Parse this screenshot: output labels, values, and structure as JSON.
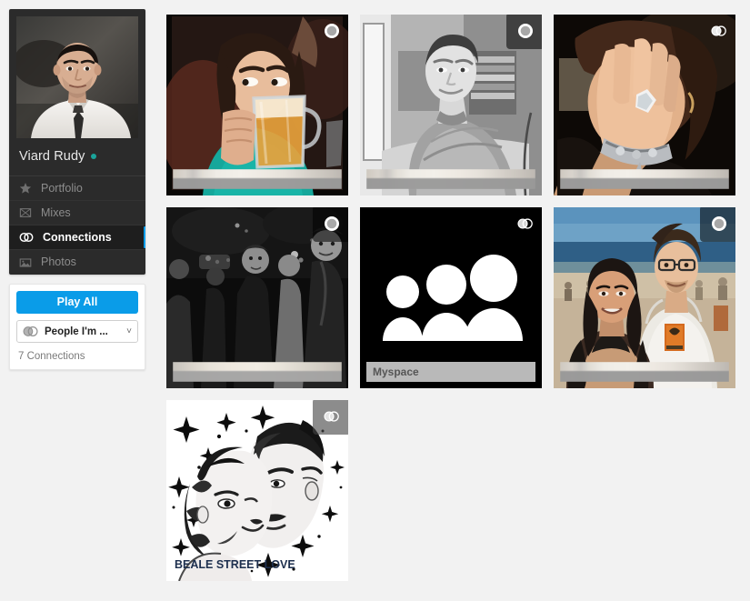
{
  "profile": {
    "name": "Viard Rudy",
    "online_dot_color": "#1aa39a",
    "avatar_alt": "portrait of man in white shirt and dark tie"
  },
  "sidebar": {
    "nav_items": [
      {
        "label": "Portfolio",
        "icon": "star-icon",
        "active": false
      },
      {
        "label": "Mixes",
        "icon": "mixes-icon",
        "active": false
      },
      {
        "label": "Connections",
        "icon": "connections-icon",
        "active": true
      },
      {
        "label": "Photos",
        "icon": "photo-icon",
        "active": false
      }
    ],
    "active_indicator_color": "#0a9ce8"
  },
  "controls": {
    "play_all_label": "Play All",
    "play_all_color": "#0a9ce8",
    "filter_label": "People I'm ...",
    "filter_icon": "connections-icon",
    "chevron": "˅",
    "connections_count": "7 Connections"
  },
  "grid": {
    "tiles": [
      {
        "id": "tile-1",
        "art": "beer-drinker",
        "badge": "circle-badge",
        "badge_hovered": false,
        "caption": "",
        "caption_redacted": true,
        "caption_style": "light"
      },
      {
        "id": "tile-2",
        "art": "man-on-couch-bw",
        "badge": "circle-badge",
        "badge_hovered": true,
        "caption": "",
        "caption_redacted": true,
        "caption_style": "light"
      },
      {
        "id": "tile-3",
        "art": "laughing-woman",
        "badge": "connections-badge",
        "badge_hovered": false,
        "caption": "",
        "caption_redacted": true,
        "caption_style": "light"
      },
      {
        "id": "tile-4",
        "art": "night-crowd-bw",
        "badge": "circle-badge",
        "badge_hovered": true,
        "caption": "",
        "caption_redacted": true,
        "caption_style": "dark"
      },
      {
        "id": "tile-5",
        "art": "myspace-people",
        "badge": "connections-badge",
        "badge_hovered": false,
        "caption": "Myspace",
        "caption_redacted": false,
        "caption_style": "myspace"
      },
      {
        "id": "tile-6",
        "art": "beach-couple",
        "badge": "circle-badge",
        "badge_hovered": true,
        "caption": "",
        "caption_redacted": true,
        "caption_style": "light"
      },
      {
        "id": "tile-7",
        "art": "beale-street-love",
        "badge": "connections-badge",
        "badge_hovered": true,
        "caption": "BEALE STREET LOVE",
        "caption_redacted": false,
        "caption_style": "beale"
      }
    ]
  }
}
